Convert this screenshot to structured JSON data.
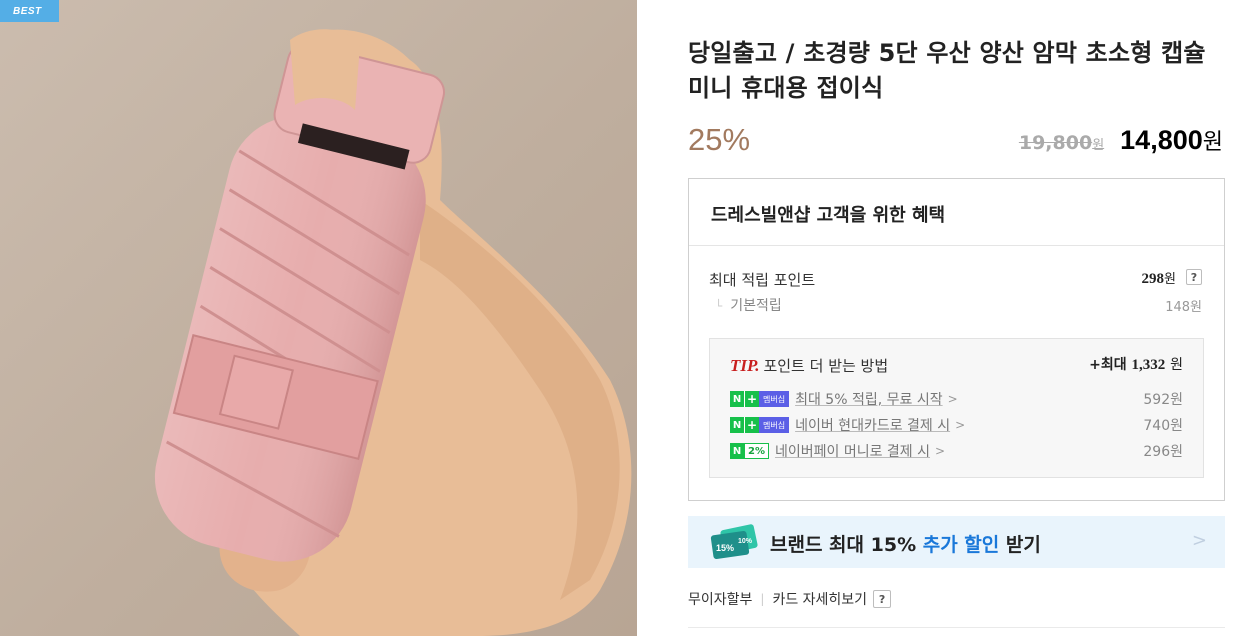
{
  "badge": {
    "text": "BEST"
  },
  "product": {
    "title": "당일출고 / 초경량 5단 우산 양산 암막 초소형 캡슐 미니 휴대용 접이식",
    "discount": "25%",
    "original_price": "19,800",
    "original_unit": "원",
    "sale_price": "14,800",
    "sale_unit": "원"
  },
  "benefits": {
    "title": "드레스빌앤샵 고객을 위한 혜택",
    "max_points_label": "최대 적립 포인트",
    "max_points_value": "298",
    "max_points_unit": "원",
    "help": "?",
    "base_corner": "└",
    "base_label": "기본적립",
    "base_value": "148원",
    "tip": {
      "label_prefix": "TIP.",
      "label": "포인트 더 받는 방법",
      "max_prefix": "+최대",
      "max_value": "1,332",
      "max_unit": "원",
      "rows": [
        {
          "badge_n": "N",
          "badge_plus": "+",
          "badge_member": "멤버십",
          "text": "최대 5% 적립, 무료 시작",
          "chevron": ">",
          "value": "592원"
        },
        {
          "badge_n": "N",
          "badge_plus": "+",
          "badge_member": "멤버십",
          "text": "네이버 현대카드로 결제 시",
          "chevron": ">",
          "value": "740원"
        },
        {
          "badge_n": "N",
          "badge_pct": "2%",
          "text": "네이버페이 머니로 결제 시",
          "chevron": ">",
          "value": "296원"
        }
      ]
    }
  },
  "coupon": {
    "text_before": "브랜드 최대 15% ",
    "text_accent": "추가 할인",
    "text_after": " 받기",
    "icon_label_1": "15%",
    "icon_label_2": "10%",
    "chevron": ">"
  },
  "installment": {
    "label": "무이자할부",
    "separator": "|",
    "card_label": "카드 자세히보기",
    "help": "?"
  },
  "colors": {
    "accent_blue": "#1a78d9",
    "discount_brown": "#a27a5f",
    "npay_green": "#17c04a",
    "tip_red": "#c81f1f",
    "best_blue": "#54aee6"
  }
}
